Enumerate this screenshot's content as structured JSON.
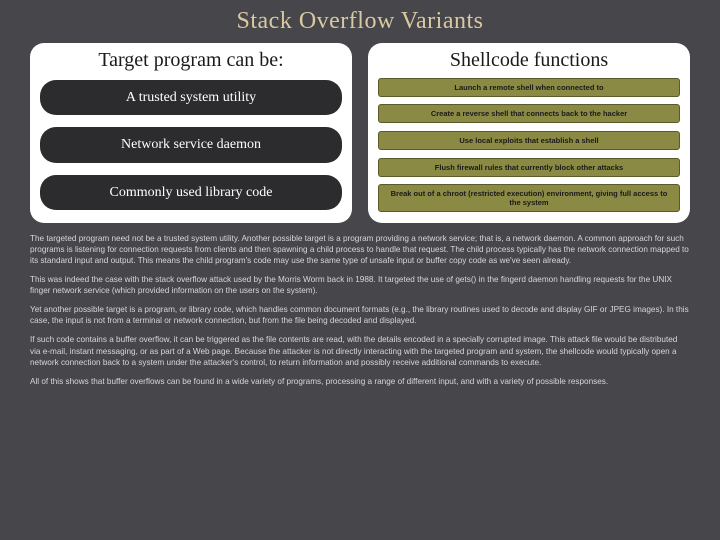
{
  "title": "Stack Overflow Variants",
  "left": {
    "heading": "Target program can be:",
    "items": [
      "A trusted system utility",
      "Network service daemon",
      "Commonly used library code"
    ]
  },
  "right": {
    "heading": "Shellcode functions",
    "items": [
      "Launch a remote shell when connected to",
      "Create a reverse shell that connects back to the hacker",
      "Use local exploits that establish a shell",
      "Flush firewall rules that currently block other attacks",
      "Break out of a chroot (restricted execution) environment, giving full access to the system"
    ]
  },
  "paragraphs": [
    "The targeted program need not be a trusted system utility. Another possible target is a program providing a network service; that is, a network daemon. A common approach for such programs is listening for connection requests from clients and then spawning a child process to handle that request. The child process typically has the network connection mapped to its standard input and output. This means the child program's code may use the same type of unsafe input or buffer copy code as we've seen already.",
    "This was indeed the case with the stack overflow attack used by the Morris Worm back in 1988. It targeted the use of gets() in the fingerd daemon handling requests for the UNIX finger network service (which provided information on the users on the system).",
    "Yet another possible target is a program, or library code, which handles common document formats (e.g., the library routines used to decode and display GIF or JPEG images). In this case, the input is not from a terminal or network connection, but from the file being decoded and displayed.",
    "If such code contains a buffer overflow, it can be triggered as the file contents are read, with the details encoded in a specially corrupted image. This attack file would be distributed via e-mail, instant messaging, or as part of a Web page. Because the attacker is not directly interacting with the targeted program and system, the shellcode would typically open a network connection back to a system under the attacker's control, to return information and possibly receive additional commands to execute.",
    "All of this shows that buffer overflows can be found in a wide variety of programs, processing a range of different input, and with a variety of possible responses."
  ]
}
